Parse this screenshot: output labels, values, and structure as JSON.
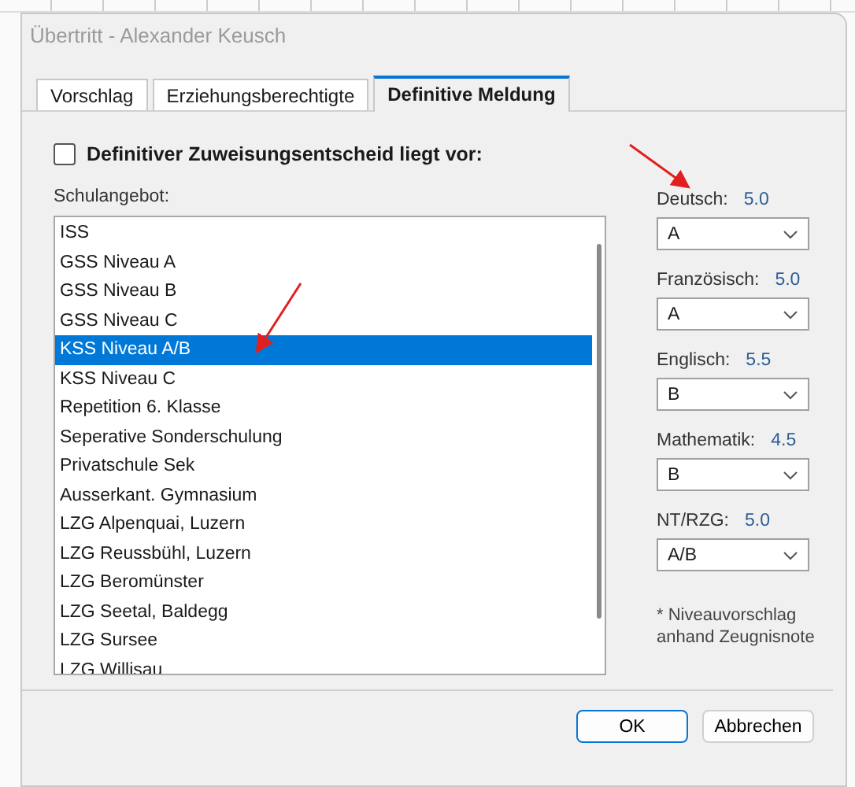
{
  "window": {
    "title": "Übertritt - Alexander Keusch"
  },
  "tabs": [
    {
      "label": "Vorschlag",
      "selected": false
    },
    {
      "label": "Erziehungsberechtigte",
      "selected": false
    },
    {
      "label": "Definitive Meldung",
      "selected": true
    }
  ],
  "decision_checkbox": {
    "label": "Definitiver Zuweisungsentscheid liegt vor:",
    "checked": false
  },
  "school_list": {
    "label": "Schulangebot:",
    "items": [
      {
        "label": "ISS",
        "selected": false
      },
      {
        "label": "GSS Niveau A",
        "selected": false
      },
      {
        "label": "GSS Niveau B",
        "selected": false
      },
      {
        "label": "GSS Niveau C",
        "selected": false
      },
      {
        "label": "KSS Niveau A/B",
        "selected": true
      },
      {
        "label": "KSS Niveau C",
        "selected": false
      },
      {
        "label": "Repetition 6. Klasse",
        "selected": false
      },
      {
        "label": "Seperative Sonderschulung",
        "selected": false
      },
      {
        "label": "Privatschule Sek",
        "selected": false
      },
      {
        "label": "Ausserkant. Gymnasium",
        "selected": false
      },
      {
        "label": "LZG Alpenquai, Luzern",
        "selected": false
      },
      {
        "label": "LZG Reussbühl, Luzern",
        "selected": false
      },
      {
        "label": "LZG Beromünster",
        "selected": false
      },
      {
        "label": "LZG Seetal, Baldegg",
        "selected": false
      },
      {
        "label": "LZG Sursee",
        "selected": false
      },
      {
        "label": "LZG Willisau",
        "selected": false
      }
    ]
  },
  "subjects": [
    {
      "label": "Deutsch:",
      "grade": "5.0",
      "level": "A"
    },
    {
      "label": "Französisch:",
      "grade": "5.0",
      "level": "A"
    },
    {
      "label": "Englisch:",
      "grade": "5.5",
      "level": "B"
    },
    {
      "label": "Mathematik:",
      "grade": "4.5",
      "level": "B"
    },
    {
      "label": "NT/RZG:",
      "grade": "5.0",
      "level": "A/B"
    }
  ],
  "footnote": {
    "mark": "*",
    "text": "Niveauvorschlag anhand Zeugnisnote"
  },
  "buttons": [
    {
      "label": "OK",
      "kind": "default"
    },
    {
      "label": "Abbrechen",
      "kind": "normal"
    }
  ]
}
